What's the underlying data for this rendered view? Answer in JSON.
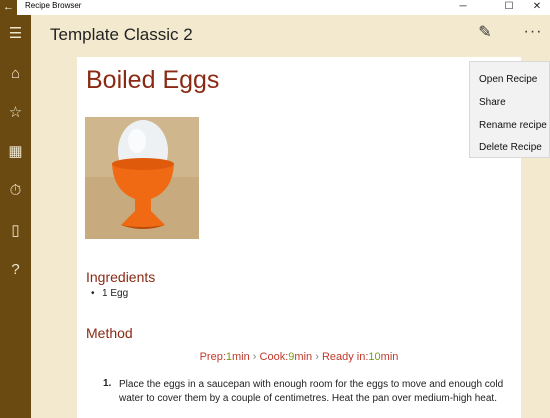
{
  "window": {
    "app_title": "Recipe Browser",
    "back_glyph": "←",
    "minimize_glyph": "─",
    "maximize_glyph": "☐",
    "close_glyph": "✕"
  },
  "sidebar": {
    "items": [
      {
        "icon": "menu-icon",
        "glyph": "☰"
      },
      {
        "icon": "home-icon",
        "glyph": "⌂"
      },
      {
        "icon": "star-icon",
        "glyph": "☆"
      },
      {
        "icon": "calendar-icon",
        "glyph": "▦"
      },
      {
        "icon": "timer-icon",
        "glyph": "⏱"
      },
      {
        "icon": "book-icon",
        "glyph": "▯"
      },
      {
        "icon": "help-icon",
        "glyph": "?"
      }
    ]
  },
  "header": {
    "title": "Template Classic  2",
    "edit_glyph": "✎",
    "more_glyph": "···"
  },
  "recipe": {
    "title": "Boiled Eggs",
    "ingredients_heading": "Ingredients",
    "ingredients": [
      "1 Egg"
    ],
    "method_heading": "Method",
    "timing": {
      "prep_label": "Prep:",
      "prep_value": "1",
      "cook_label": "Cook:",
      "cook_value": "9",
      "ready_label": "Ready in:",
      "ready_value": "10",
      "unit": "min",
      "separator": "›"
    },
    "steps": [
      {
        "number": "1.",
        "text": "Place the eggs in a saucepan with enough room for the eggs to move and enough cold water to cover them by a couple of centimetres. Heat the pan over medium-high heat."
      }
    ]
  },
  "menu": {
    "items": [
      "Open Recipe",
      "Share",
      "Rename recipe",
      "Delete Recipe"
    ]
  },
  "colors": {
    "sidebar": "#6b4a11",
    "background": "#f3e9cf",
    "accent": "#8b2a14",
    "timing_value": "#7a9a14"
  }
}
